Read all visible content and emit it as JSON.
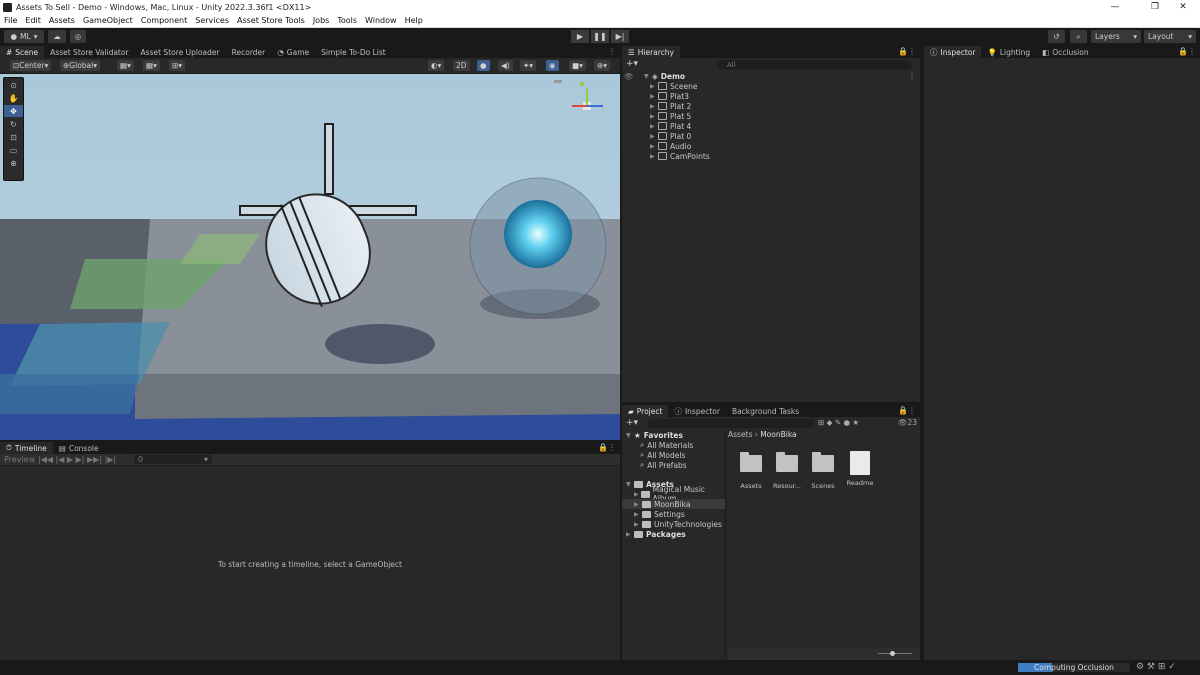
{
  "window": {
    "title": "Assets To Sell - Demo - Windows, Mac, Linux - Unity 2022.3.36f1 <DX11>",
    "minimize": "—",
    "maximize": "❐",
    "close": "✕"
  },
  "menu": [
    "File",
    "Edit",
    "Assets",
    "GameObject",
    "Component",
    "Services",
    "Asset Store Tools",
    "Jobs",
    "Tools",
    "Window",
    "Help"
  ],
  "toolbar": {
    "account": "ML",
    "layers": "Layers",
    "layout": "Layout"
  },
  "scene_tabs": [
    "Scene",
    "Asset Store Validator",
    "Asset Store Uploader",
    "Recorder",
    "Game",
    "Simple To-Do List"
  ],
  "scene_tools": {
    "pivot": "Center",
    "space": "Global",
    "mode_2d": "2D"
  },
  "hierarchy": {
    "tab": "Hierarchy",
    "search_placeholder": "All",
    "root": "Demo",
    "items": [
      "Sceene",
      "Plat3",
      "Plat 2",
      "Plat 5",
      "Plat 4",
      "Plat 0",
      "Audio",
      "CamPoints"
    ]
  },
  "inspector_tabs": [
    "Inspector",
    "Lighting",
    "Occlusion"
  ],
  "bottom_tabs": [
    "Timeline",
    "Console"
  ],
  "timeline": {
    "preview": "Preview",
    "frame": "0",
    "message": "To start creating a timeline, select a GameObject"
  },
  "project": {
    "tabs": [
      "Project",
      "Inspector",
      "Background Tasks"
    ],
    "count": "23",
    "favorites": {
      "title": "Favorites",
      "items": [
        "All Materials",
        "All Models",
        "All Prefabs"
      ]
    },
    "assets": {
      "title": "Assets",
      "items": [
        "Magical Music Album",
        "MoonBika",
        "Settings",
        "UnityTechnologies"
      ]
    },
    "packages": "Packages",
    "breadcrumb": [
      "Assets",
      "MoonBika"
    ],
    "grid": [
      "Assets",
      "Resour...",
      "Scenes",
      "Readme"
    ]
  },
  "status": {
    "text": "Computing Occlusion",
    "progress": 0.3
  },
  "colors": {
    "selection": "#2c5d87",
    "progress": "#3e7ec0"
  }
}
